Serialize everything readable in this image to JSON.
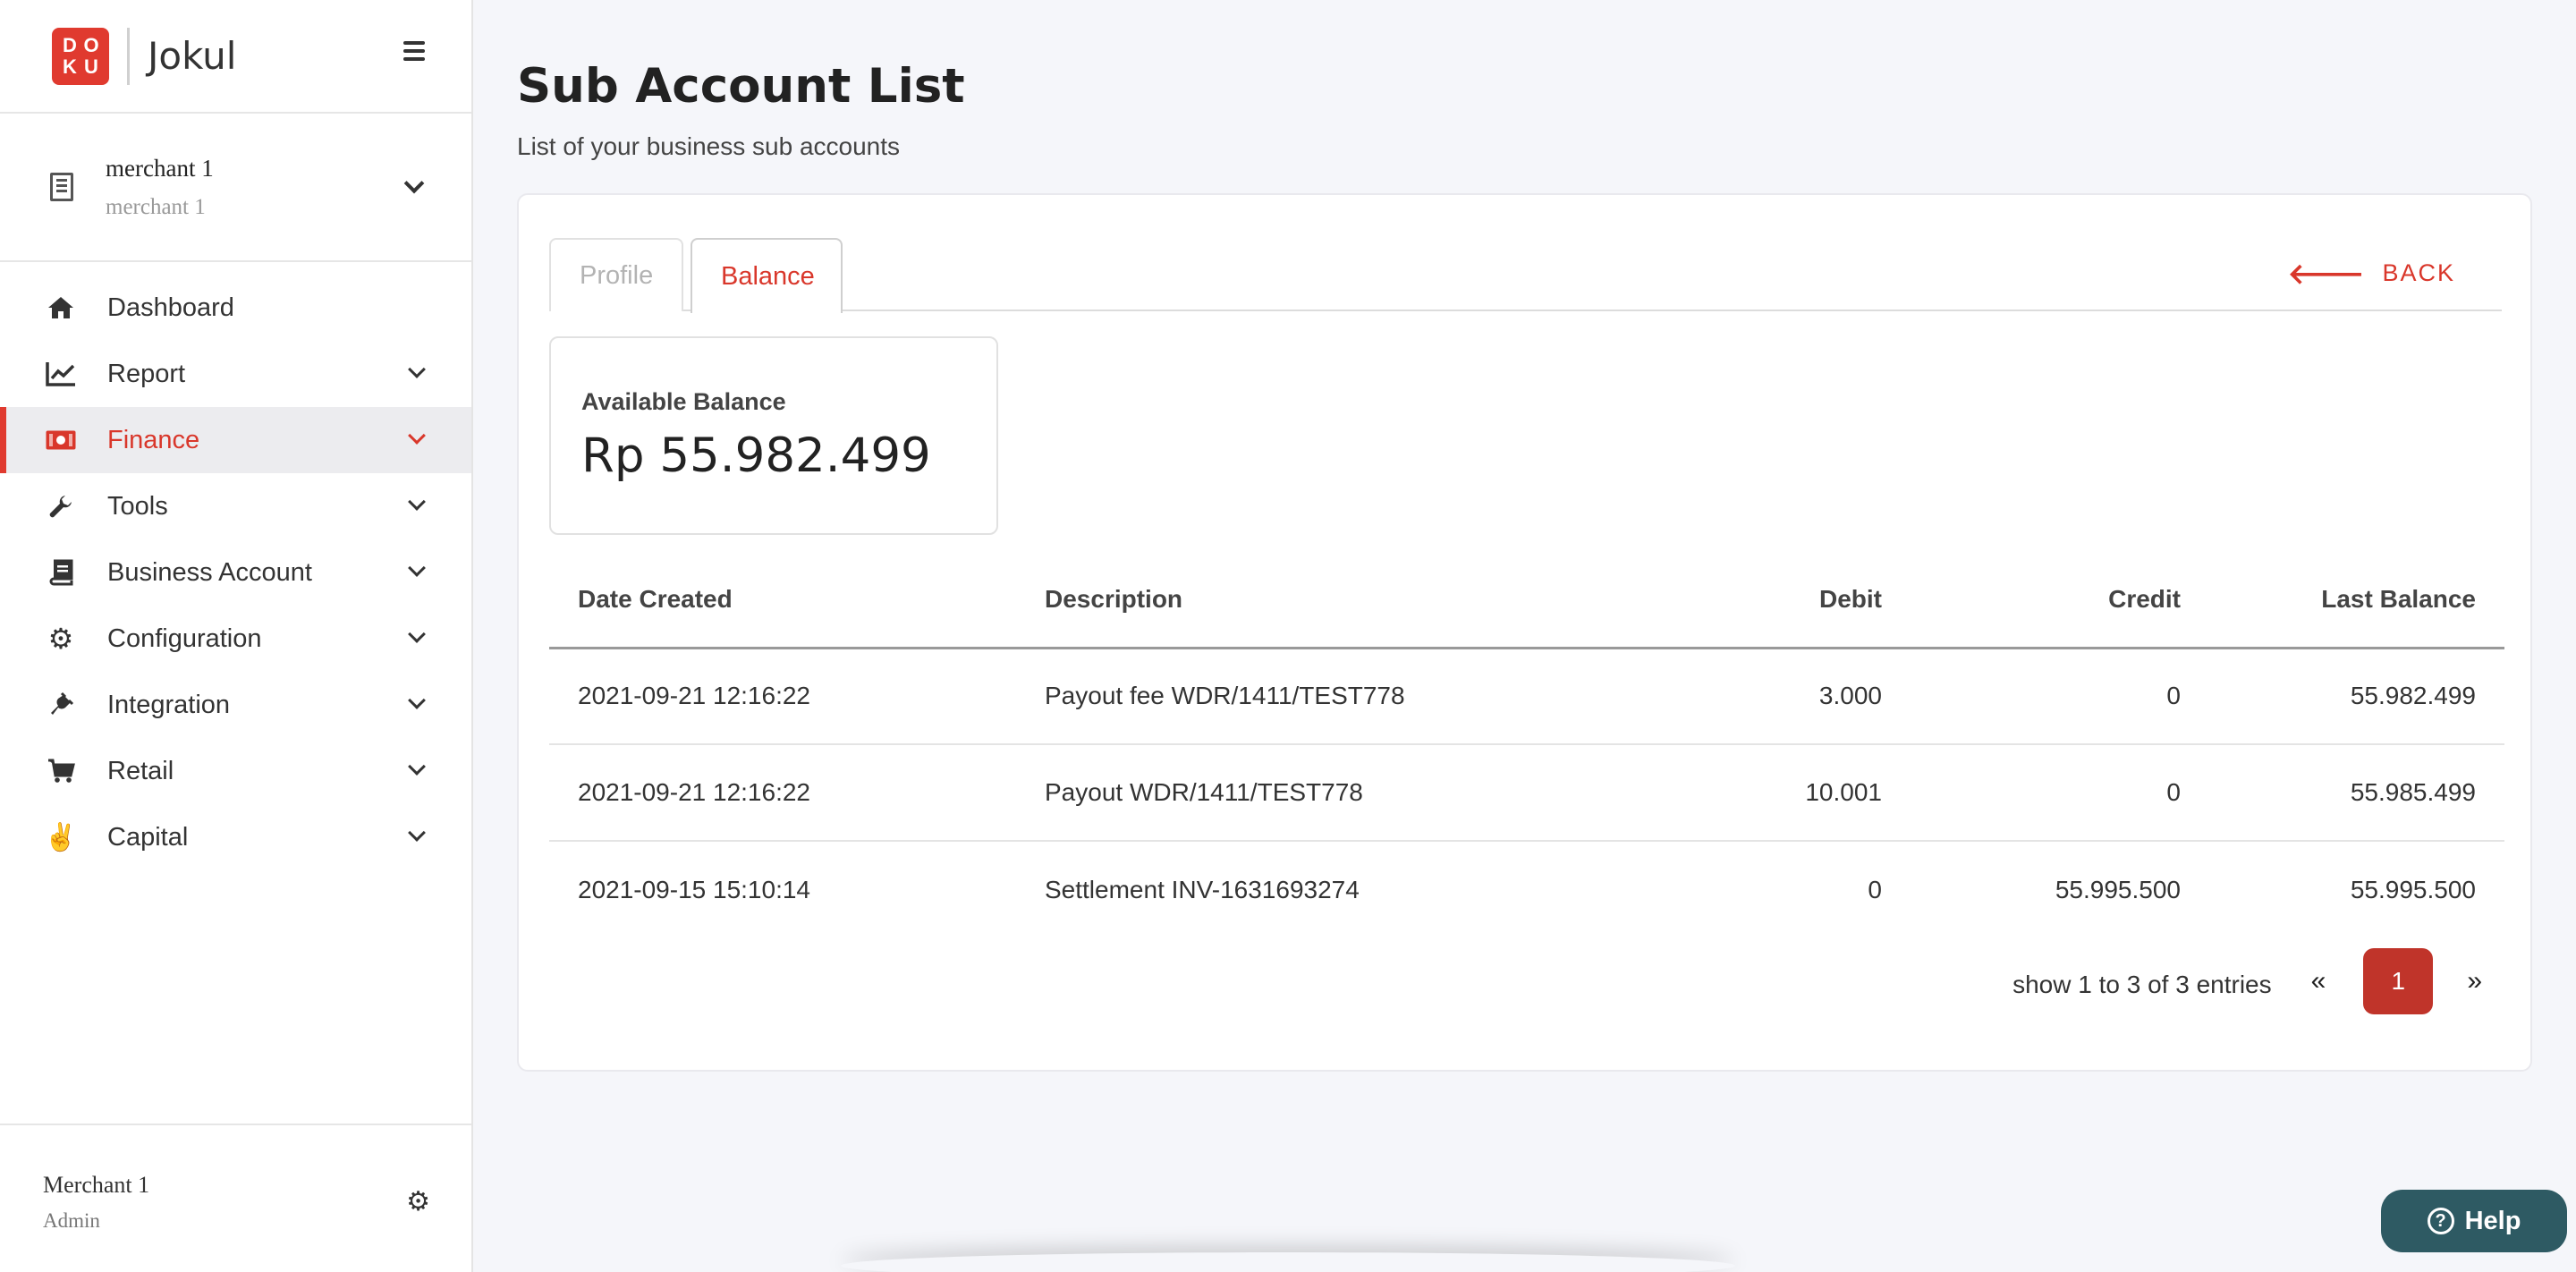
{
  "brand": {
    "logo_letters": [
      "D",
      "O",
      "K",
      "U"
    ],
    "name": "Jokul"
  },
  "merchant_selector": {
    "name": "merchant 1",
    "sub": "merchant 1"
  },
  "nav": {
    "items": [
      {
        "label": "Dashboard",
        "icon": "home-icon",
        "glyph": "⌂"
      },
      {
        "label": "Report",
        "icon": "chart-line-icon",
        "glyph": "📈"
      },
      {
        "label": "Finance",
        "icon": "money-bill-icon",
        "glyph": "💵"
      },
      {
        "label": "Tools",
        "icon": "wrench-icon",
        "glyph": "🔧"
      },
      {
        "label": "Business Account",
        "icon": "book-icon",
        "glyph": "📘"
      },
      {
        "label": "Configuration",
        "icon": "gears-icon",
        "glyph": "⚙"
      },
      {
        "label": "Integration",
        "icon": "plug-icon",
        "glyph": "🔌"
      },
      {
        "label": "Retail",
        "icon": "cart-icon",
        "glyph": "🛒"
      },
      {
        "label": "Capital",
        "icon": "peace-hand-icon",
        "glyph": "✌"
      }
    ]
  },
  "user": {
    "name": "Merchant 1",
    "role": "Admin"
  },
  "page": {
    "title": "Sub Account List",
    "subtitle": "List of your business sub accounts"
  },
  "tabs": {
    "profile": "Profile",
    "balance": "Balance"
  },
  "back_label": "BACK",
  "balance": {
    "label": "Available Balance",
    "value": "Rp 55.982.499"
  },
  "table": {
    "headers": [
      "Date Created",
      "Description",
      "Debit",
      "Credit",
      "Last Balance"
    ],
    "rows": [
      [
        "2021-09-21 12:16:22",
        "Payout fee WDR/1411/TEST778",
        "3.000",
        "0",
        "55.982.499"
      ],
      [
        "2021-09-21 12:16:22",
        "Payout WDR/1411/TEST778",
        "10.001",
        "0",
        "55.985.499"
      ],
      [
        "2021-09-15 15:10:14",
        "Settlement INV-1631693274",
        "0",
        "55.995.500",
        "55.995.500"
      ]
    ]
  },
  "pagination": {
    "info": "show 1 to 3 of 3 entries",
    "prev": "«",
    "page": "1",
    "next": "»"
  },
  "help_label": "Help",
  "colors": {
    "accent": "#d9372b",
    "page_active": "#c0342a",
    "help_bg": "#2e5a63"
  }
}
